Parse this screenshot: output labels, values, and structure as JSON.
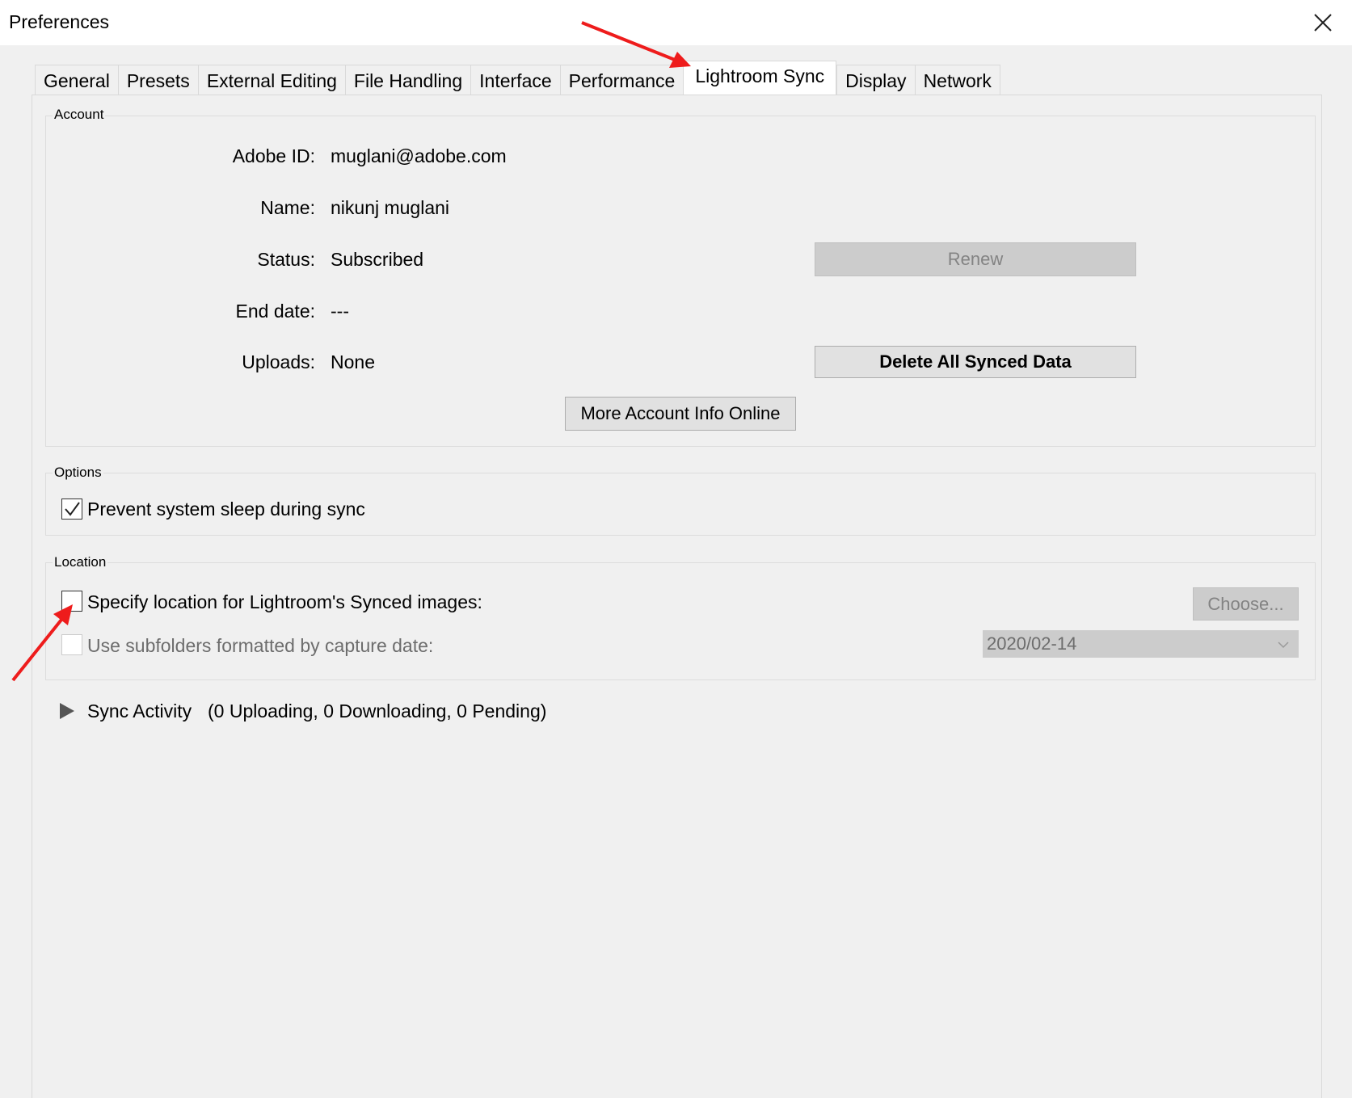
{
  "window": {
    "title": "Preferences",
    "close_icon": "close-icon"
  },
  "tabs": [
    {
      "label": "General"
    },
    {
      "label": "Presets"
    },
    {
      "label": "External Editing"
    },
    {
      "label": "File Handling"
    },
    {
      "label": "Interface"
    },
    {
      "label": "Performance"
    },
    {
      "label": "Lightroom Sync",
      "active": true
    },
    {
      "label": "Display"
    },
    {
      "label": "Network"
    }
  ],
  "account": {
    "legend": "Account",
    "adobe_id_label": "Adobe ID:",
    "adobe_id_value": "muglani@adobe.com",
    "name_label": "Name:",
    "name_value": "nikunj muglani",
    "status_label": "Status:",
    "status_value": "Subscribed",
    "end_date_label": "End date:",
    "end_date_value": "---",
    "uploads_label": "Uploads:",
    "uploads_value": "None",
    "renew_button": "Renew",
    "delete_button": "Delete All Synced Data",
    "more_info_button": "More Account Info Online"
  },
  "options": {
    "legend": "Options",
    "prevent_sleep_label": "Prevent system sleep during sync",
    "prevent_sleep_checked": true
  },
  "location": {
    "legend": "Location",
    "specify_label": "Specify location for Lightroom's Synced images:",
    "specify_checked": false,
    "choose_button": "Choose...",
    "subfolders_label": "Use subfolders formatted by capture date:",
    "subfolders_checked": false,
    "date_format_value": "2020/02-14"
  },
  "sync_activity": {
    "label": "Sync Activity",
    "summary": "(0 Uploading, 0 Downloading, 0 Pending)"
  },
  "colors": {
    "annotation_arrow": "#ee1c1c",
    "background": "#f0f0f0"
  }
}
